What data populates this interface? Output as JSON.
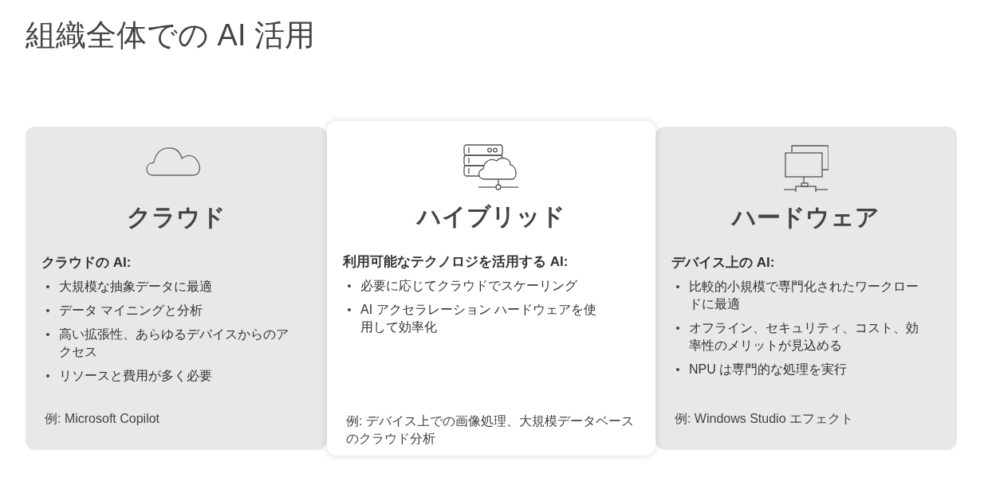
{
  "title": "組織全体での AI 活用",
  "cards": [
    {
      "kind": "cloud",
      "selected": false,
      "heading": "クラウド",
      "subheading": "クラウドの AI:",
      "bullets": [
        "大規模な抽象データに最適",
        "データ マイニングと分析",
        "高い拡張性、あらゆるデバイスからのアクセス",
        "リソースと費用が多く必要"
      ],
      "example": "例: Microsoft Copilot"
    },
    {
      "kind": "hybrid",
      "selected": true,
      "heading": "ハイブリッド",
      "subheading": "利用可能なテクノロジを活用する AI:",
      "bullets": [
        "必要に応じてクラウドでスケーリング",
        "AI アクセラレーション ハードウェアを使用して効率化"
      ],
      "example": "例: デバイス上での画像処理、大規模データベースのクラウド分析"
    },
    {
      "kind": "device",
      "selected": false,
      "heading": "ハードウェア",
      "subheading": "デバイス上の AI:",
      "bullets": [
        "比較的小規模で専門化されたワークロードに最適",
        "オフライン、セキュリティ、コスト、効率性のメリットが見込める",
        "NPU は専門的な処理を実行"
      ],
      "example": "例: Windows Studio エフェクト"
    }
  ]
}
